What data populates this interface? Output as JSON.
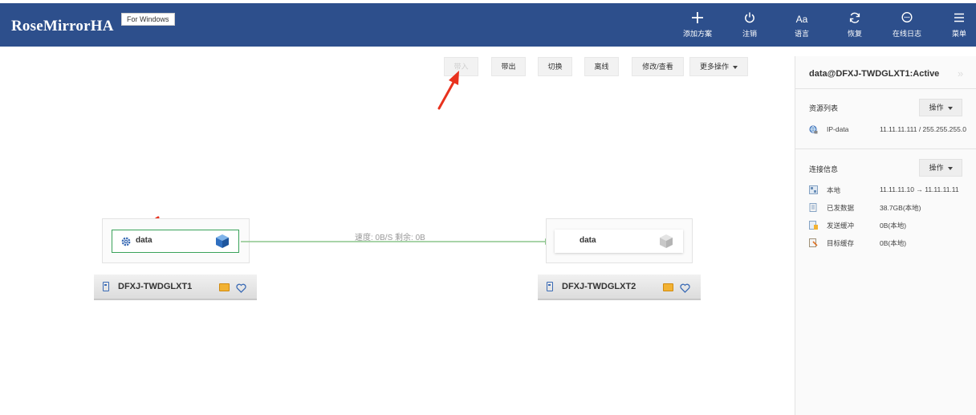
{
  "app": {
    "title": "RoseMirrorHA",
    "badge": "For Windows"
  },
  "header_buttons": [
    {
      "label": "添加方案",
      "icon": "plus-icon"
    },
    {
      "label": "注销",
      "icon": "power-icon"
    },
    {
      "label": "语言",
      "icon": "language-icon",
      "glyph": "Aa"
    },
    {
      "label": "恢复",
      "icon": "refresh-icon"
    },
    {
      "label": "在线日志",
      "icon": "chat-icon"
    },
    {
      "label": "菜单",
      "icon": "menu-icon"
    }
  ],
  "toolbar": {
    "start": "带入",
    "bring_out": "带出",
    "switch": "切换",
    "offline": "离线",
    "edit": "修改/查看",
    "more": "更多操作"
  },
  "topology": {
    "link_status": "速度: 0B/S 剩余: 0B",
    "nodes": [
      {
        "name": "DFXJ-TWDGLXT1",
        "resource": "data",
        "selected": true
      },
      {
        "name": "DFXJ-TWDGLXT2",
        "resource": "data",
        "selected": false
      }
    ]
  },
  "panel": {
    "title": "data@DFXJ-TWDGLXT1:Active",
    "resources": {
      "title": "资源列表",
      "op_label": "操作",
      "items": [
        {
          "label": "IP-data",
          "value": "11.11.11.111 / 255.255.255.0",
          "icon": "ip-resource-icon"
        }
      ]
    },
    "connection": {
      "title": "连接信息",
      "op_label": "操作",
      "items": [
        {
          "label": "本地",
          "value": "11.11.11.10 → 11.11.11.11",
          "icon": "network-icon"
        },
        {
          "label": "已发数据",
          "value": "38.7GB(本地)",
          "icon": "sent-data-icon"
        },
        {
          "label": "发送缓冲",
          "value": "0B(本地)",
          "icon": "send-buffer-icon"
        },
        {
          "label": "目标缓存",
          "value": "0B(本地)",
          "icon": "target-cache-icon"
        }
      ]
    }
  },
  "colors": {
    "header_bg": "#2d4f8c",
    "link_green": "#8cc68c",
    "selected_border": "#3aa35a",
    "annotation_red": "#e8321e"
  }
}
